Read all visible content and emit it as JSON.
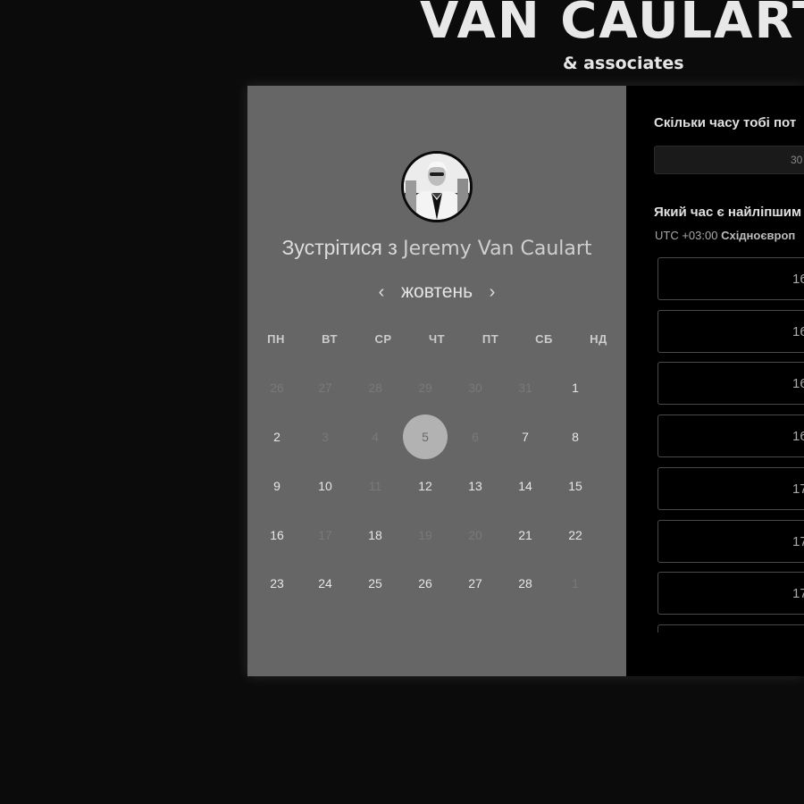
{
  "brand": {
    "name": "VAN CAULART",
    "subtitle": "& associates"
  },
  "scheduler": {
    "title_prefix": "Зустрітися з",
    "host_name": "Jeremy Van Caulart",
    "month": "жовтень",
    "prev_icon": "chevron-left-icon",
    "next_icon": "chevron-right-icon",
    "weekdays": [
      "ПН",
      "ВТ",
      "СР",
      "ЧТ",
      "ПТ",
      "СБ",
      "НД"
    ],
    "weeks": [
      [
        {
          "d": "26",
          "muted": true
        },
        {
          "d": "27",
          "muted": true
        },
        {
          "d": "28",
          "muted": true
        },
        {
          "d": "29",
          "muted": true
        },
        {
          "d": "30",
          "muted": true
        },
        {
          "d": "31",
          "muted": true
        },
        {
          "d": "1",
          "muted": false
        }
      ],
      [
        {
          "d": "2",
          "muted": false
        },
        {
          "d": "3",
          "muted": true
        },
        {
          "d": "4",
          "muted": true
        },
        {
          "d": "5",
          "muted": false,
          "selected": true
        },
        {
          "d": "6",
          "muted": true
        },
        {
          "d": "7",
          "muted": false
        },
        {
          "d": "8",
          "muted": false
        }
      ],
      [
        {
          "d": "9",
          "muted": false
        },
        {
          "d": "10",
          "muted": false
        },
        {
          "d": "11",
          "muted": true
        },
        {
          "d": "12",
          "muted": false
        },
        {
          "d": "13",
          "muted": false
        },
        {
          "d": "14",
          "muted": false
        },
        {
          "d": "15",
          "muted": false
        }
      ],
      [
        {
          "d": "16",
          "muted": false
        },
        {
          "d": "17",
          "muted": true
        },
        {
          "d": "18",
          "muted": false
        },
        {
          "d": "19",
          "muted": true
        },
        {
          "d": "20",
          "muted": true
        },
        {
          "d": "21",
          "muted": false
        },
        {
          "d": "22",
          "muted": false
        }
      ],
      [
        {
          "d": "23",
          "muted": false
        },
        {
          "d": "24",
          "muted": false
        },
        {
          "d": "25",
          "muted": false
        },
        {
          "d": "26",
          "muted": false
        },
        {
          "d": "27",
          "muted": false
        },
        {
          "d": "28",
          "muted": false
        },
        {
          "d": "1",
          "muted": true
        }
      ]
    ]
  },
  "booking": {
    "duration_question": "Скільки часу тобі пот",
    "duration_value": "30",
    "time_question": "Який час є найліпшим",
    "timezone_offset": "UTC +03:00",
    "timezone_name": "Східноєвроп",
    "slots": [
      "16",
      "16",
      "16",
      "16",
      "17",
      "17",
      "17",
      ""
    ]
  },
  "colors": {
    "page_bg": "#0b0b0b",
    "calendar_bg": "#666666",
    "booking_bg": "#000000",
    "selected_day": "#b2b2b2"
  }
}
